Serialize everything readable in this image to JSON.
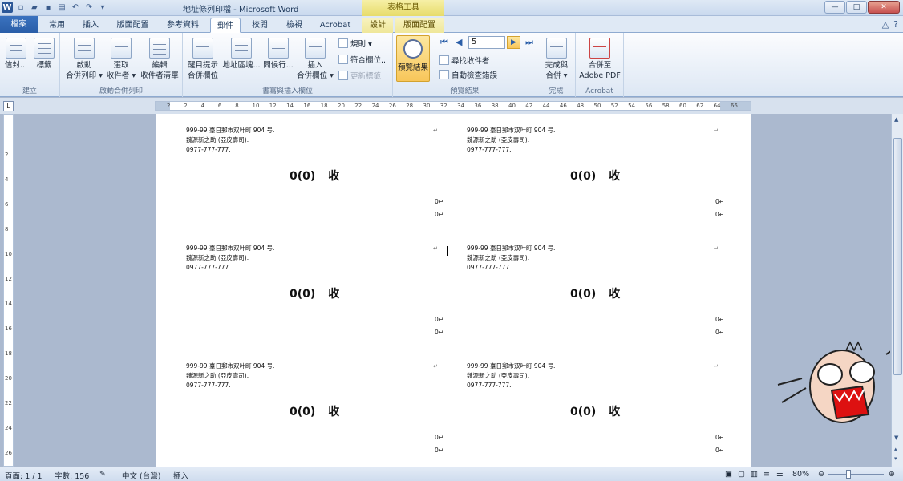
{
  "title_bar": {
    "window_title": "地址條列印檔 - Microsoft Word",
    "context_group": "表格工具",
    "controls": {
      "minimize": "—",
      "maximize": "□",
      "close": "✕"
    }
  },
  "tabs": [
    "檔案",
    "常用",
    "插入",
    "版面配置",
    "參考資料",
    "郵件",
    "校閱",
    "檢視",
    "Acrobat",
    "設計",
    "版面配置"
  ],
  "active_tab": "郵件",
  "ribbon": {
    "groups": {
      "create": {
        "label": "建立",
        "envelopes": "信封...",
        "labels": "標籤"
      },
      "start": {
        "label": "啟動合併列印",
        "start_l1": "啟動",
        "start_l2": "合併列印 ▾",
        "select_l1": "選取",
        "select_l2": "收件者 ▾",
        "edit_l1": "編輯",
        "edit_l2": "收件者清單"
      },
      "fields": {
        "label": "書寫與插入欄位",
        "highlight_l1": "醒目提示",
        "highlight_l2": "合併欄位",
        "address_block": "地址區塊...",
        "greeting": "問候行...",
        "insert_l1": "插入",
        "insert_l2": "合併欄位 ▾",
        "rules": "規則 ▾",
        "match": "符合欄位...",
        "update": "更新標籤"
      },
      "preview": {
        "label": "預覽結果",
        "preview_btn": "預覽結果",
        "record": "5",
        "find": "尋找收件者",
        "check": "自動檢查錯誤"
      },
      "finish": {
        "label": "完成",
        "finish_l1": "完成與",
        "finish_l2": "合併 ▾"
      },
      "acrobat": {
        "label": "Acrobat",
        "merge_l1": "合併至",
        "merge_l2": "Adobe PDF"
      }
    }
  },
  "ruler": {
    "ticks": [
      "2",
      "2",
      "4",
      "6",
      "8",
      "10",
      "12",
      "14",
      "16",
      "18",
      "20",
      "22",
      "24",
      "26",
      "28",
      "30",
      "32",
      "34",
      "36",
      "38",
      "40",
      "42",
      "44",
      "46",
      "48",
      "50",
      "52",
      "54",
      "56",
      "58",
      "60",
      "62",
      "64",
      "66"
    ]
  },
  "vruler": {
    "ticks": [
      "2",
      "4",
      "6",
      "8",
      "10",
      "12",
      "14",
      "16",
      "18",
      "20",
      "22",
      "24",
      "26"
    ]
  },
  "labels": [
    {
      "line1": "999-99 臺日郵市双叶町 904 号.",
      "line2": "魏源新之助 (亞皮壽司).",
      "line3": "0977-777-777.",
      "name": "0(0)",
      "suffix": "收",
      "zero1": "0↵",
      "zero2": "0↵"
    },
    {
      "line1": "999-99 臺日郵市双叶町 904 号.",
      "line2": "魏源新之助 (亞皮壽司).",
      "line3": "0977-777-777.",
      "name": "0(0)",
      "suffix": "收",
      "zero1": "0↵",
      "zero2": "0↵"
    },
    {
      "line1": "999-99 臺日郵市双叶町 904 号.",
      "line2": "魏源新之助 (亞皮壽司).",
      "line3": "0977-777-777.",
      "name": "0(0)",
      "suffix": "收",
      "zero1": "0↵",
      "zero2": "0↵"
    },
    {
      "line1": "999-99 臺日郵市双叶町 904 号.",
      "line2": "魏源新之助 (亞皮壽司).",
      "line3": "0977-777-777.",
      "name": "0(0)",
      "suffix": "收",
      "zero1": "0↵",
      "zero2": "0↵"
    },
    {
      "line1": "999-99 臺日郵市双叶町 904 号.",
      "line2": "魏源新之助 (亞皮壽司).",
      "line3": "0977-777-777.",
      "name": "0(0)",
      "suffix": "收",
      "zero1": "0↵",
      "zero2": "0↵"
    },
    {
      "line1": "999-99 臺日郵市双叶町 904 号.",
      "line2": "魏源新之助 (亞皮壽司).",
      "line3": "0977-777-777.",
      "name": "0(0)",
      "suffix": "收",
      "zero1": "0↵",
      "zero2": "0↵"
    }
  ],
  "status_bar": {
    "page": "頁面: 1 / 1",
    "words": "字數: 156",
    "language": "中文 (台灣)",
    "mode": "插入",
    "zoom": "80%"
  },
  "colors": {
    "file_tab": "#2a5ea8",
    "context_tab": "#efe79a",
    "ribbon_bg": "#dde7f4",
    "doc_bg": "#abb9cf"
  }
}
